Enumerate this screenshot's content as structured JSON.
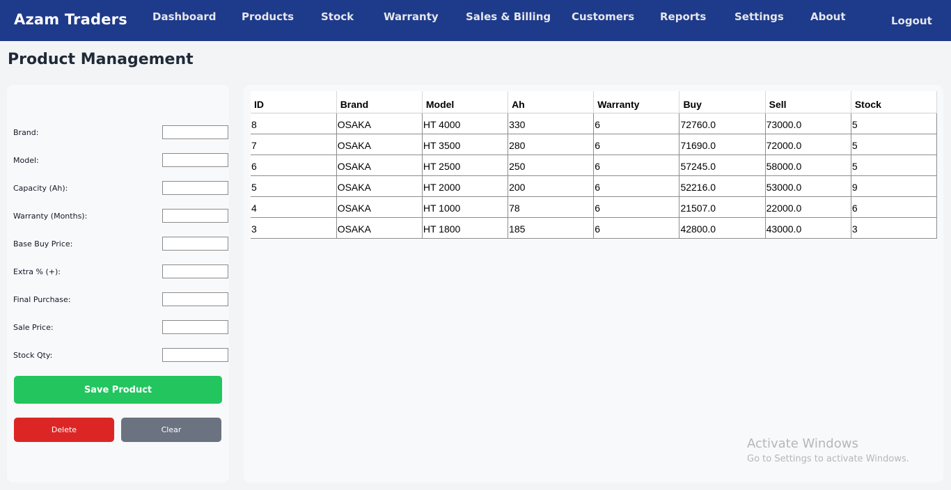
{
  "app": {
    "brand": "Azam Traders",
    "logout_label": "Logout"
  },
  "nav": {
    "items": [
      {
        "label": "Dashboard"
      },
      {
        "label": "Products"
      },
      {
        "label": "Stock"
      },
      {
        "label": "Warranty"
      },
      {
        "label": "Sales & Billing"
      },
      {
        "label": "Customers"
      },
      {
        "label": "Reports"
      },
      {
        "label": "Settings"
      },
      {
        "label": "About"
      }
    ]
  },
  "page": {
    "title": "Product Management"
  },
  "form": {
    "fields": [
      {
        "label": "Brand:",
        "value": ""
      },
      {
        "label": "Model:",
        "value": ""
      },
      {
        "label": "Capacity (Ah):",
        "value": ""
      },
      {
        "label": "Warranty (Months):",
        "value": ""
      },
      {
        "label": "Base Buy Price:",
        "value": ""
      },
      {
        "label": "Extra % (+):",
        "value": ""
      },
      {
        "label": "Final Purchase:",
        "value": ""
      },
      {
        "label": "Sale Price:",
        "value": ""
      },
      {
        "label": "Stock Qty:",
        "value": ""
      }
    ],
    "save_label": "Save Product",
    "delete_label": "Delete",
    "clear_label": "Clear"
  },
  "table": {
    "columns": [
      "ID",
      "Brand",
      "Model",
      "Ah",
      "Warranty",
      "Buy",
      "Sell",
      "Stock"
    ],
    "rows": [
      [
        "8",
        "OSAKA",
        "HT 4000",
        "330",
        "6",
        "72760.0",
        "73000.0",
        "5"
      ],
      [
        "7",
        "OSAKA",
        "HT 3500",
        "280",
        "6",
        "71690.0",
        "72000.0",
        "5"
      ],
      [
        "6",
        "OSAKA",
        "HT 2500",
        "250",
        "6",
        "57245.0",
        "58000.0",
        "5"
      ],
      [
        "5",
        "OSAKA",
        "HT 2000",
        "200",
        "6",
        "52216.0",
        "53000.0",
        "9"
      ],
      [
        "4",
        "OSAKA",
        "HT 1000",
        "78",
        "6",
        "21507.0",
        "22000.0",
        "6"
      ],
      [
        "3",
        "OSAKA",
        "HT 1800",
        "185",
        "6",
        "42800.0",
        "43000.0",
        "3"
      ]
    ]
  },
  "watermark": {
    "title": "Activate Windows",
    "subtitle": "Go to Settings to activate Windows."
  },
  "colors": {
    "navbar": "#1e3a8a",
    "background": "#f3f4f6",
    "save": "#22c55e",
    "delete": "#dc2626",
    "clear": "#6b7280"
  }
}
